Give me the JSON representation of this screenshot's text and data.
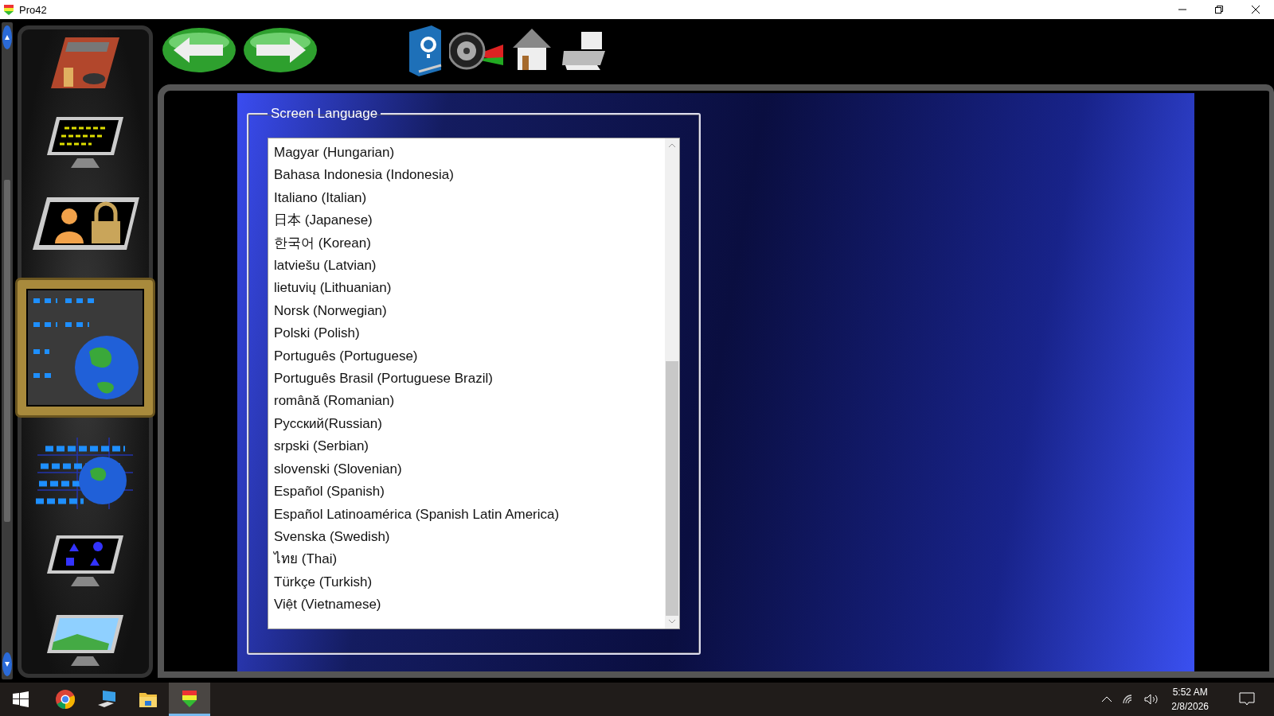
{
  "window": {
    "title": "Pro42"
  },
  "sidebar": {
    "items": [
      {
        "kind": "garage",
        "selected": false
      },
      {
        "kind": "measurements",
        "selected": false
      },
      {
        "kind": "user-lock",
        "selected": false
      },
      {
        "kind": "language",
        "selected": true
      },
      {
        "kind": "specs",
        "selected": false
      },
      {
        "kind": "shapes",
        "selected": false
      },
      {
        "kind": "display",
        "selected": false
      }
    ]
  },
  "toolbar": {
    "buttons": [
      {
        "kind": "back"
      },
      {
        "kind": "forward"
      },
      {
        "kind": "help"
      },
      {
        "kind": "wheel"
      },
      {
        "kind": "home"
      },
      {
        "kind": "print"
      }
    ]
  },
  "language_group": {
    "title": "Screen Language",
    "items": [
      {
        "label": "Magyar (Hungarian)"
      },
      {
        "label": "Bahasa Indonesia (Indonesia)"
      },
      {
        "label": "Italiano (Italian)"
      },
      {
        "label": "日本 (Japanese)"
      },
      {
        "label": "한국어 (Korean)"
      },
      {
        "label": "latviešu (Latvian)"
      },
      {
        "label": "lietuvių (Lithuanian)"
      },
      {
        "label": "Norsk (Norwegian)"
      },
      {
        "label": "Polski (Polish)"
      },
      {
        "label": "Português (Portuguese)"
      },
      {
        "label": "Português Brasil (Portuguese Brazil)"
      },
      {
        "label": "română (Romanian)"
      },
      {
        "label": "Русский(Russian)"
      },
      {
        "label": "srpski (Serbian)"
      },
      {
        "label": "slovenski (Slovenian)"
      },
      {
        "label": "Español (Spanish)"
      },
      {
        "label": "Español Latinoamérica (Spanish Latin America)"
      },
      {
        "label": "Svenska (Swedish)"
      },
      {
        "label": "ไทย (Thai)"
      },
      {
        "label": "Türkçe (Turkish)"
      },
      {
        "label": "Việt (Vietnamese)"
      }
    ]
  },
  "taskbar": {
    "apps": [
      {
        "kind": "chrome",
        "selected": false
      },
      {
        "kind": "computer",
        "selected": false
      },
      {
        "kind": "folder",
        "selected": false
      },
      {
        "kind": "app",
        "selected": true
      }
    ],
    "time": "5:52 AM",
    "date": "2/8/2026"
  }
}
